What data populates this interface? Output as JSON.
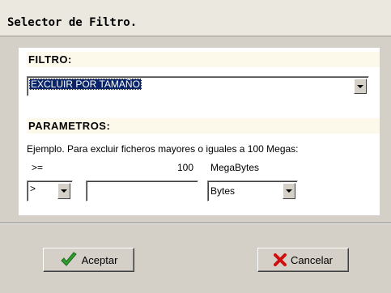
{
  "window": {
    "title": "Selector de Filtro."
  },
  "filtro": {
    "section_label": "FILTRO:",
    "selected_option": "EXCLUIR POR TAMAÑO"
  },
  "parametros": {
    "section_label": "PARAMETROS:",
    "example_text": "Ejemplo. Para excluir ficheros mayores o iguales a 100 Megas:",
    "example_operator": ">=",
    "example_value": "100",
    "example_unit": "MegaBytes",
    "operator_selected": ">",
    "value_input": "",
    "unit_selected": "Bytes"
  },
  "buttons": {
    "accept_label": "Aceptar",
    "cancel_label": "Cancelar"
  },
  "colors": {
    "accept_icon": "#2e9e2e",
    "cancel_icon": "#d01010",
    "selection": "#0a246a",
    "section_band": "#fdf9ea"
  },
  "icons": {
    "accept": "checkmark-icon",
    "cancel": "x-icon",
    "dropdown": "chevron-down-icon"
  }
}
